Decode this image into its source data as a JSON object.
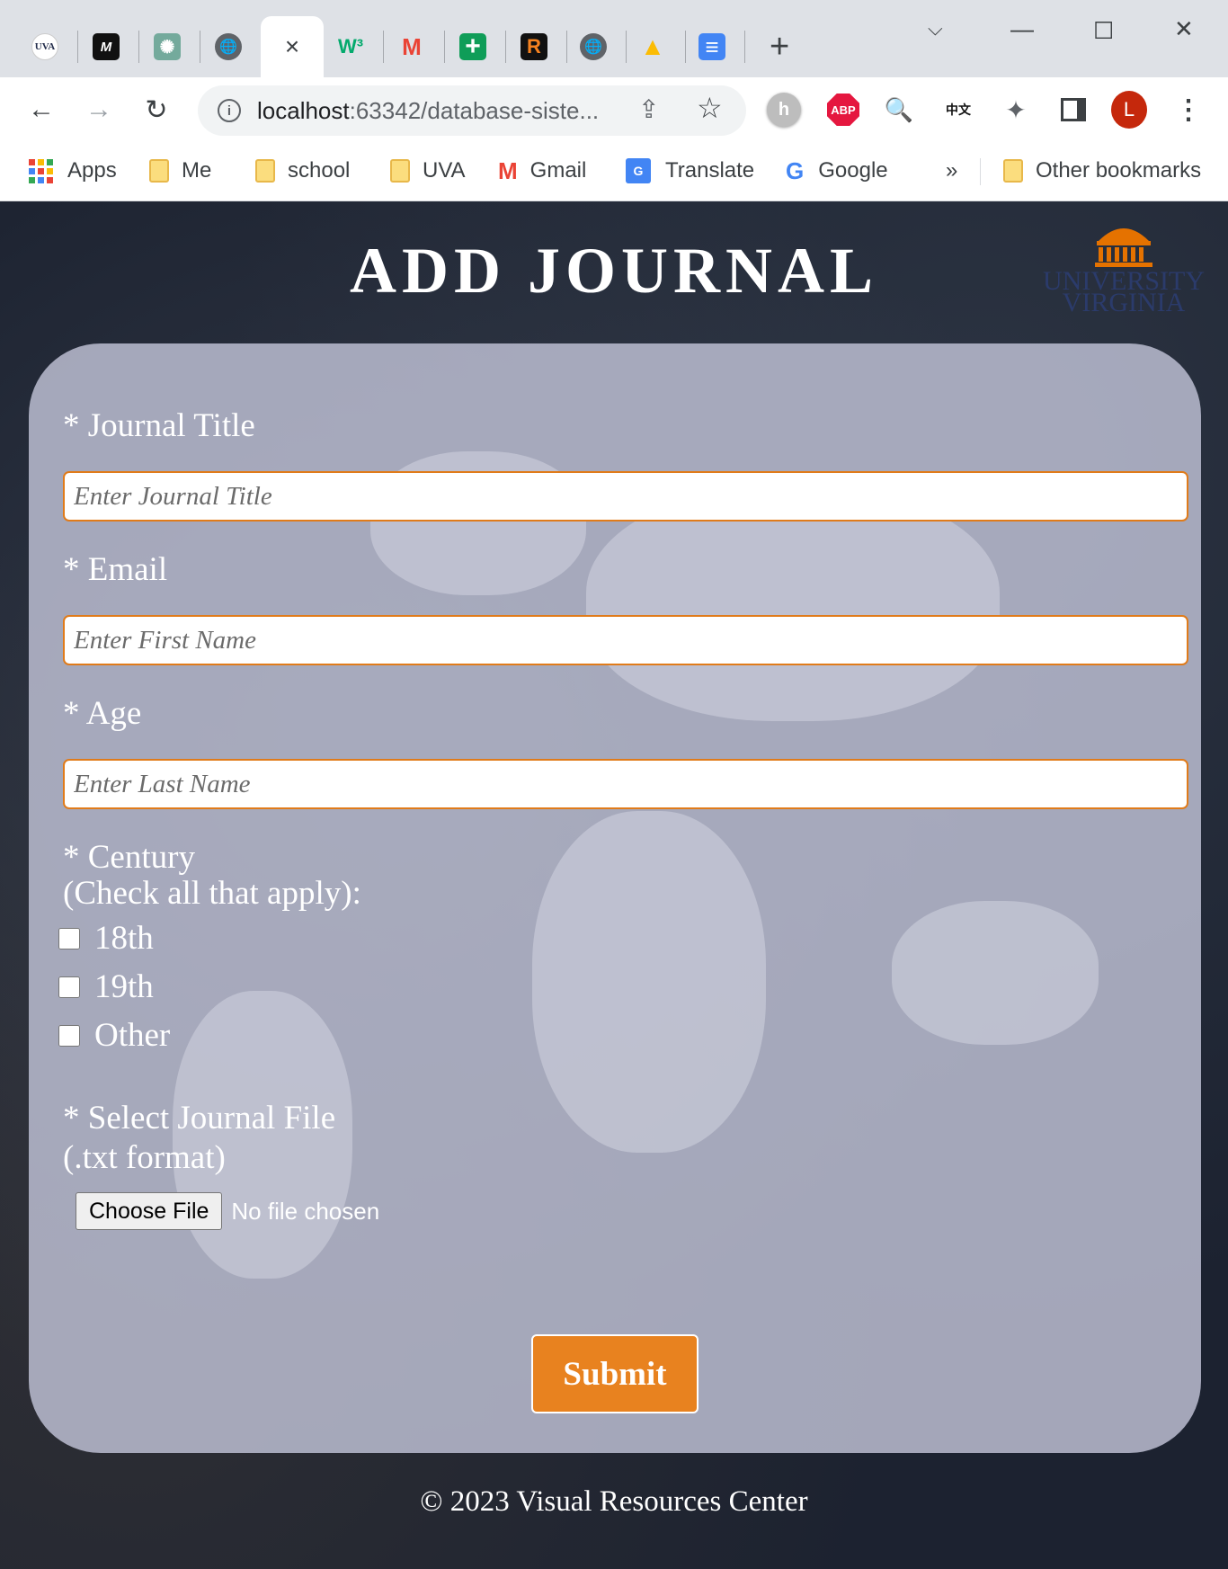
{
  "browser": {
    "active_tab_close": "×",
    "tabs": [
      {
        "icon": "uva-favicon",
        "text": "UVA"
      },
      {
        "icon": "m-favicon",
        "text": "M"
      },
      {
        "icon": "openai-favicon",
        "text": "✺"
      },
      {
        "icon": "globe-favicon",
        "text": "🌐"
      },
      {
        "icon": "w3-favicon",
        "text": "W³"
      },
      {
        "icon": "gmail-favicon",
        "text": "M"
      },
      {
        "icon": "sheets-favicon",
        "text": "+"
      },
      {
        "icon": "r-favicon",
        "text": "R"
      },
      {
        "icon": "globe-favicon",
        "text": "🌐"
      },
      {
        "icon": "drive-favicon",
        "text": "▲"
      },
      {
        "icon": "docs-favicon",
        "text": "≡"
      }
    ],
    "new_tab": "+",
    "url_host": "localhost",
    "url_rest": ":63342/database-siste...",
    "profile_initial": "L",
    "extensions": {
      "abp": "ABP",
      "chinese": "中文"
    },
    "bookmarks": {
      "apps": "Apps",
      "me": "Me",
      "school": "school",
      "uva": "UVA",
      "gmail": "Gmail",
      "translate": "Translate",
      "google": "Google",
      "more": "»",
      "other": "Other bookmarks"
    }
  },
  "page": {
    "title": "ADD JOURNAL",
    "logo_line1": "UNIVERSITY",
    "logo_line2": "VIRGINIA",
    "form": {
      "journal_title_label": "* Journal Title",
      "journal_title_placeholder": "Enter Journal Title",
      "email_label": "* Email",
      "email_placeholder": "Enter First Name",
      "age_label": "* Age",
      "age_placeholder": "Enter Last Name",
      "century_label": "* Century",
      "century_hint": "(Check all that apply):",
      "century_options": [
        "18th",
        "19th",
        "Other"
      ],
      "file_label": "* Select Journal File",
      "file_hint": "(.txt format)",
      "file_button": "Choose File",
      "file_status": "No file chosen",
      "submit": "Submit"
    },
    "footer": "© 2023 Visual Resources Center"
  },
  "colors": {
    "accent": "#e8821f",
    "input_border": "#e07b1a",
    "card": "#babdd0",
    "background": "#1c2230"
  }
}
